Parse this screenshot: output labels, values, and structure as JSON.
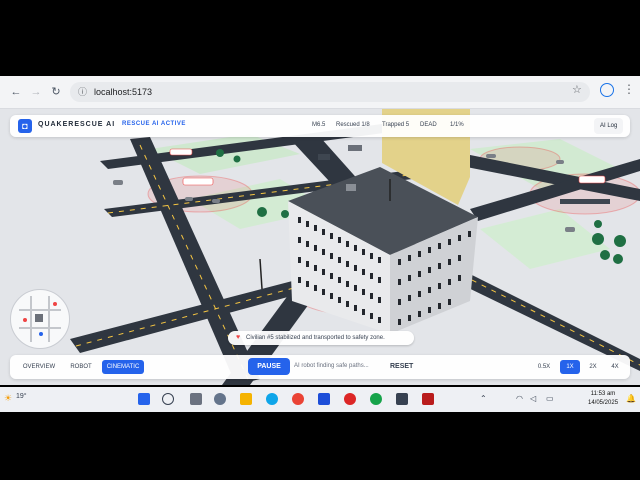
{
  "browser": {
    "url": "localhost:5173"
  },
  "app": {
    "brand": "QUAKERESCUE AI",
    "ai_status": "RESCUE AI ACTIVE",
    "stats": {
      "mag": "M6.5",
      "rescued": "Rescued 1/8",
      "trapped": "Trapped 5",
      "dead": "DEAD",
      "elapsed": "1/1%"
    },
    "ai_log_label": "AI Log"
  },
  "toast": {
    "message": "Civilian #5 stabilized and transported to safety zone."
  },
  "controls": {
    "views": [
      "OVERVIEW",
      "ROBOT",
      "CINEMATIC"
    ],
    "active_view": "CINEMATIC",
    "pause_label": "PAUSE",
    "path_status": "AI robot finding safe paths...",
    "reset_label": "RESET",
    "speeds": [
      "0.5X",
      "1X",
      "2X",
      "4X"
    ],
    "active_speed": "1X"
  },
  "taskbar": {
    "weather": "19°",
    "time": "11:53 am",
    "date": "14/05/2025"
  },
  "colors": {
    "accent": "#2563eb",
    "danger_zone": "#ef4444",
    "road": "#2f3640",
    "ground": "#e2e4e8"
  }
}
